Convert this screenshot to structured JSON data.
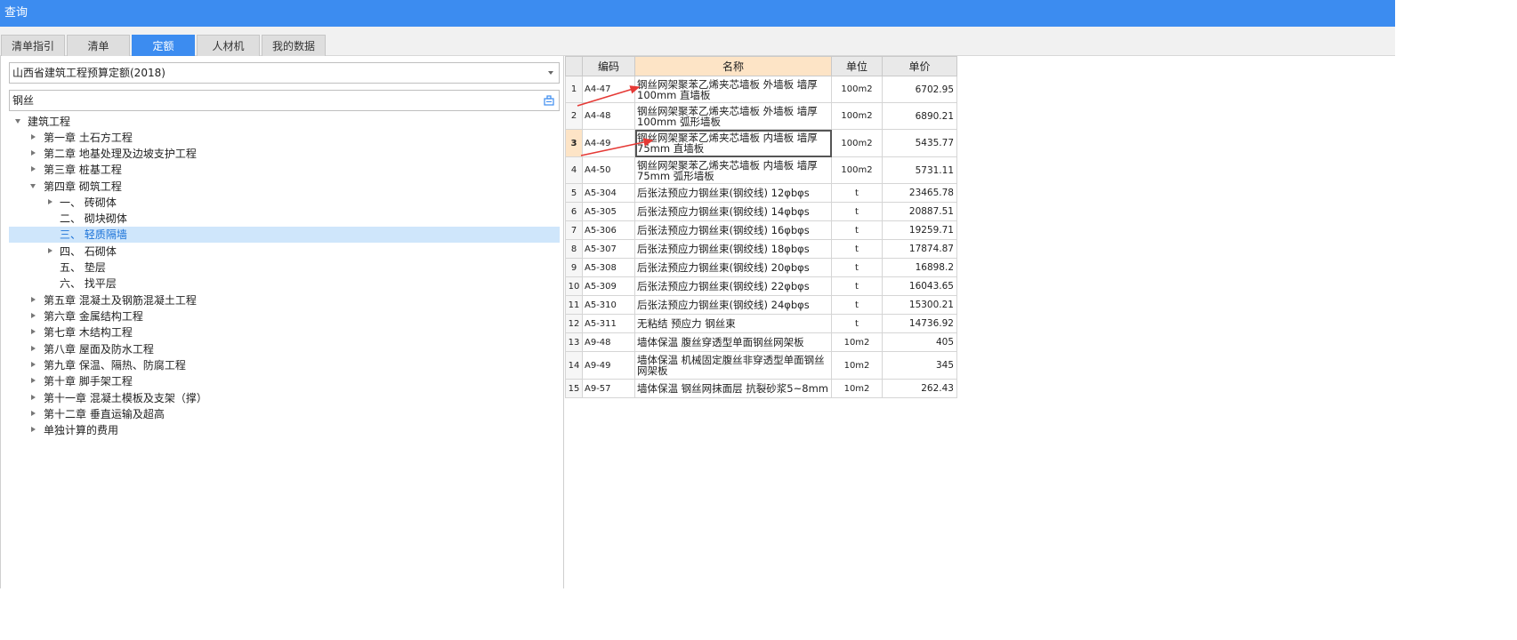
{
  "window": {
    "title": "查询"
  },
  "tabs": [
    {
      "label": "清单指引"
    },
    {
      "label": "清单"
    },
    {
      "label": "定额"
    },
    {
      "label": "人材机"
    },
    {
      "label": "我的数据"
    }
  ],
  "colors": {
    "accent": "#3c8cf0",
    "selection_bg": "#cfe6fb",
    "header_highlight": "#fde4c6",
    "arrow": "#e53935"
  },
  "library_select": {
    "value": "山西省建筑工程预算定额(2018)"
  },
  "search": {
    "value": "钢丝",
    "icon": "search-icon"
  },
  "tree": {
    "root": "建筑工程",
    "chapters": [
      "第一章 土石方工程",
      "第二章 地基处理及边坡支护工程",
      "第三章 桩基工程",
      "第四章 砌筑工程",
      "第五章 混凝土及钢筋混凝土工程",
      "第六章 金属结构工程",
      "第七章 木结构工程",
      "第八章 屋面及防水工程",
      "第九章 保温、隔热、防腐工程",
      "第十章 脚手架工程",
      "第十一章 混凝土模板及支架（撑）",
      "第十二章 垂直运输及超高",
      "单独计算的费用"
    ],
    "sections": [
      "一、 砖砌体",
      "二、 砌块砌体",
      "三、 轻质隔墙",
      "四、 石砌体",
      "五、 垫层",
      "六、 找平层"
    ]
  },
  "grid": {
    "headers": [
      "",
      "编码",
      "名称",
      "单位",
      "单价"
    ],
    "rows": [
      {
        "no": "1",
        "code": "A4-47",
        "name": "钢丝网架聚苯乙烯夹芯墙板 外墙板 墙厚100mm 直墙板",
        "unit": "100m2",
        "price": "6702.95"
      },
      {
        "no": "2",
        "code": "A4-48",
        "name": "钢丝网架聚苯乙烯夹芯墙板 外墙板 墙厚100mm 弧形墙板",
        "unit": "100m2",
        "price": "6890.21"
      },
      {
        "no": "3",
        "code": "A4-49",
        "name": "钢丝网架聚苯乙烯夹芯墙板 内墙板 墙厚75mm 直墙板",
        "unit": "100m2",
        "price": "5435.77"
      },
      {
        "no": "4",
        "code": "A4-50",
        "name": "钢丝网架聚苯乙烯夹芯墙板 内墙板 墙厚75mm 弧形墙板",
        "unit": "100m2",
        "price": "5731.11"
      },
      {
        "no": "5",
        "code": "A5-304",
        "name": "后张法预应力钢丝束(钢绞线) 12φbφs",
        "unit": "t",
        "price": "23465.78"
      },
      {
        "no": "6",
        "code": "A5-305",
        "name": "后张法预应力钢丝束(钢绞线) 14φbφs",
        "unit": "t",
        "price": "20887.51"
      },
      {
        "no": "7",
        "code": "A5-306",
        "name": "后张法预应力钢丝束(钢绞线) 16φbφs",
        "unit": "t",
        "price": "19259.71"
      },
      {
        "no": "8",
        "code": "A5-307",
        "name": "后张法预应力钢丝束(钢绞线) 18φbφs",
        "unit": "t",
        "price": "17874.87"
      },
      {
        "no": "9",
        "code": "A5-308",
        "name": "后张法预应力钢丝束(钢绞线) 20φbφs",
        "unit": "t",
        "price": "16898.2"
      },
      {
        "no": "10",
        "code": "A5-309",
        "name": "后张法预应力钢丝束(钢绞线) 22φbφs",
        "unit": "t",
        "price": "16043.65"
      },
      {
        "no": "11",
        "code": "A5-310",
        "name": "后张法预应力钢丝束(钢绞线) 24φbφs",
        "unit": "t",
        "price": "15300.21"
      },
      {
        "no": "12",
        "code": "A5-311",
        "name": "无粘结 预应力 钢丝束",
        "unit": "t",
        "price": "14736.92"
      },
      {
        "no": "13",
        "code": "A9-48",
        "name": "墙体保温 腹丝穿透型单面钢丝网架板",
        "unit": "10m2",
        "price": "405"
      },
      {
        "no": "14",
        "code": "A9-49",
        "name": "墙体保温 机械固定腹丝非穿透型单面钢丝网架板",
        "unit": "10m2",
        "price": "345"
      },
      {
        "no": "15",
        "code": "A9-57",
        "name": "墙体保温 钢丝网抹面层 抗裂砂浆5~8mm",
        "unit": "10m2",
        "price": "262.43"
      }
    ]
  }
}
